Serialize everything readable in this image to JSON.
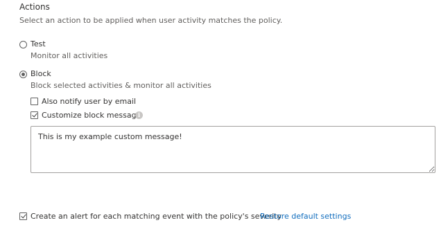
{
  "actions": {
    "title": "Actions",
    "description": "Select an action to be applied when user activity matches the policy.",
    "options": [
      {
        "label": "Test",
        "description": "Monitor all activities",
        "selected": false
      },
      {
        "label": "Block",
        "description": "Block selected activities & monitor all activities",
        "selected": true
      }
    ],
    "block_settings": {
      "notify_label": "Also notify user by email",
      "notify_checked": false,
      "customize_label": "Customize block message",
      "customize_checked": true,
      "info_icon": "info-icon",
      "message_value": "This is my example custom message!"
    }
  },
  "footer": {
    "alert_label": "Create an alert for each matching event with the policy's severity",
    "alert_checked": true,
    "restore_link": "Restore default settings"
  }
}
